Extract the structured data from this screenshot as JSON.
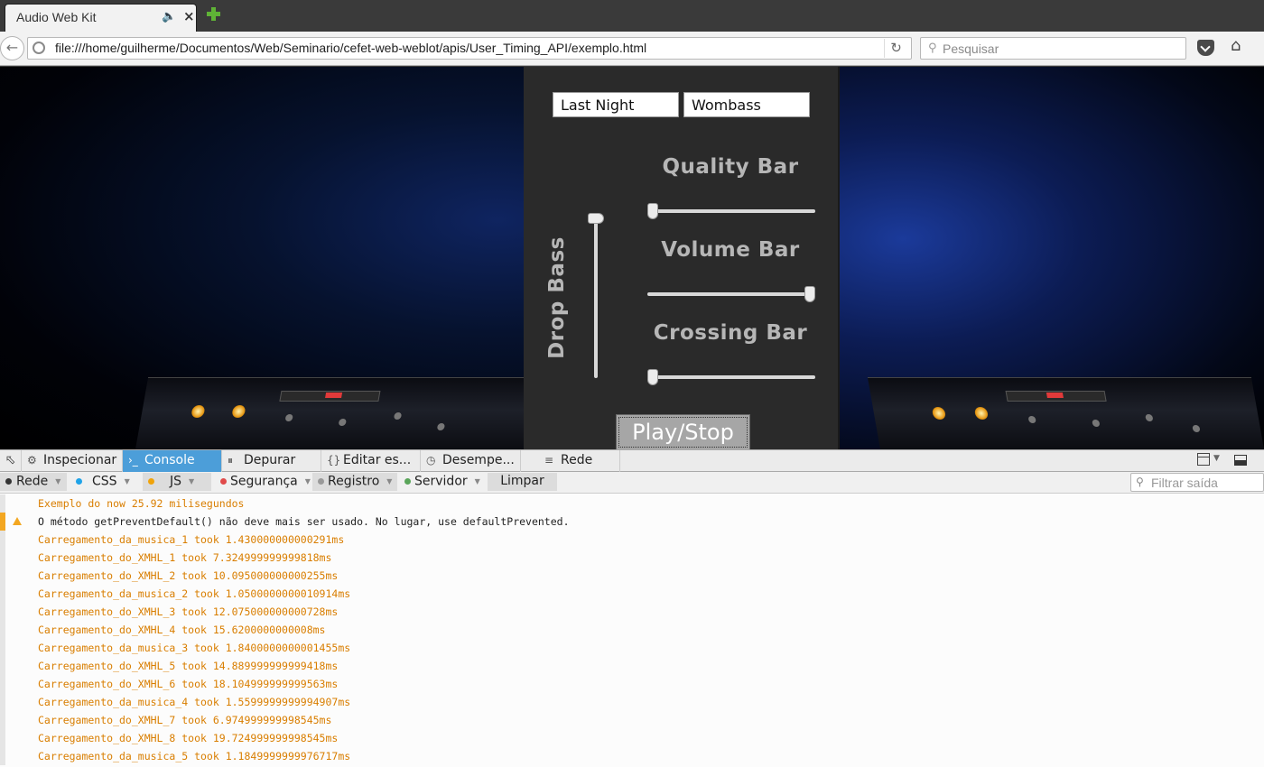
{
  "browser": {
    "tab_title": "Audio Web Kit",
    "url": "file:///home/guilherme/Documentos/Web/Seminario/cefet-web-weblot/apis/User_Timing_API/exemplo.html",
    "search_placeholder": "Pesquisar"
  },
  "player": {
    "song_value": "Last Night",
    "artist_value": "Wombass",
    "quality_label": "Quality Bar",
    "volume_label": "Volume Bar",
    "crossing_label": "Crossing Bar",
    "drop_bass_label": "Drop Bass",
    "play_label": "Play/Stop",
    "quality_level": 0.0,
    "volume_level": 1.0,
    "crossing_level": 0.0,
    "drop_bass_level": 1.0
  },
  "devtools": {
    "tabs": [
      "Inspecionar",
      "Console",
      "Depurar",
      "Editar es...",
      "Desempe...",
      "Rede"
    ],
    "active_tab": "Console",
    "filters": [
      "Rede",
      "CSS",
      "JS",
      "Segurança",
      "Registro",
      "Servidor"
    ],
    "clear_label": "Limpar",
    "filter_placeholder": "Filtrar saída",
    "colors": {
      "Rede": "#333333",
      "CSS": "#1fa3e8",
      "JS": "#f0a30a",
      "Segurança": "#e04a4a",
      "Registro": "#999999",
      "Servidor": "#5aa55a"
    }
  },
  "console": {
    "messages": [
      {
        "level": "log",
        "text": "Exemplo do now 25.92 milisegundos"
      },
      {
        "level": "warn",
        "text": "O método getPreventDefault() não deve mais ser usado. No lugar, use defaultPrevented."
      },
      {
        "level": "log",
        "text": "Carregamento_da_musica_1 took 1.430000000000291ms"
      },
      {
        "level": "log",
        "text": "Carregamento_do_XMHL_1 took 7.324999999999818ms"
      },
      {
        "level": "log",
        "text": "Carregamento_do_XMHL_2 took 10.095000000000255ms"
      },
      {
        "level": "log",
        "text": "Carregamento_da_musica_2 took 1.0500000000010914ms"
      },
      {
        "level": "log",
        "text": "Carregamento_do_XMHL_3 took 12.075000000000728ms"
      },
      {
        "level": "log",
        "text": "Carregamento_do_XMHL_4 took 15.6200000000008ms"
      },
      {
        "level": "log",
        "text": "Carregamento_da_musica_3 took 1.8400000000001455ms"
      },
      {
        "level": "log",
        "text": "Carregamento_do_XMHL_5 took 14.889999999999418ms"
      },
      {
        "level": "log",
        "text": "Carregamento_do_XMHL_6 took 18.104999999999563ms"
      },
      {
        "level": "log",
        "text": "Carregamento_da_musica_4 took 1.5599999999994907ms"
      },
      {
        "level": "log",
        "text": "Carregamento_do_XMHL_7 took 6.974999999998545ms"
      },
      {
        "level": "log",
        "text": "Carregamento_do_XMHL_8 took 19.724999999998545ms"
      },
      {
        "level": "log",
        "text": "Carregamento_da_musica_5 took 1.1849999999976717ms"
      }
    ]
  }
}
